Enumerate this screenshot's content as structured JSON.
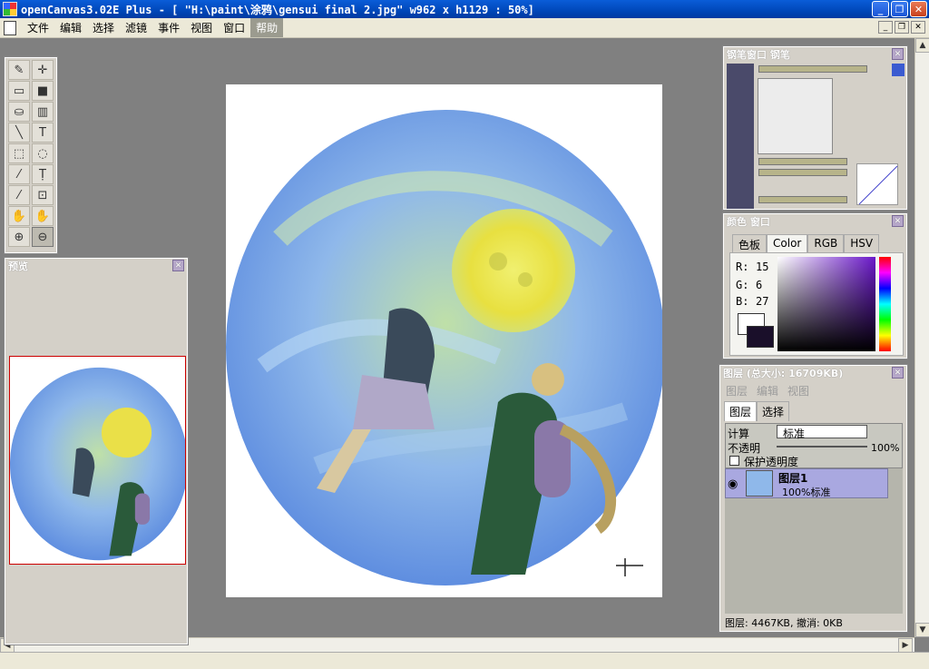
{
  "window": {
    "title": "openCanvas3.02E Plus - [ \"H:\\paint\\涂鸦\\gensui final 2.jpg\" w962 x h1129 : 50%]"
  },
  "menu": {
    "items": [
      "文件",
      "编辑",
      "选择",
      "滤镜",
      "事件",
      "视图",
      "窗口",
      "帮助"
    ]
  },
  "tools": {
    "icons": [
      "pen-icon",
      "move-icon",
      "eraser-icon",
      "fill-rect-icon",
      "bucket-icon",
      "gradient-icon",
      "line-icon",
      "text-icon",
      "rect-select-icon",
      "lasso-icon",
      "magic-wand-icon",
      "text-select-icon",
      "eyedropper-icon",
      "crop-icon",
      "hand-icon",
      "rotate-hand-icon",
      "zoom-in-icon",
      "zoom-out-icon"
    ],
    "glyphs": [
      "✎",
      "✛",
      "▭",
      "■",
      "⛀",
      "▥",
      "╲",
      "T",
      "⬚",
      "◌",
      "⁄",
      "Ṭ",
      "⁄",
      "⊡",
      "✋",
      "✋",
      "⊕",
      "⊖"
    ]
  },
  "preview": {
    "title": "预览"
  },
  "brush": {
    "title": "钢笔窗口  钢笔"
  },
  "color": {
    "title": "颜色  窗口",
    "tabs": [
      "色板",
      "Color",
      "RGB",
      "HSV"
    ],
    "active_tab": "Color",
    "r_label": "R:",
    "r_value": "15",
    "g_label": "G:",
    "g_value": "6",
    "b_label": "B:",
    "b_value": "27",
    "foreground": "#1a0f2a",
    "background": "#ffffff"
  },
  "layers": {
    "title": "图层 (总大小: 16709KB)",
    "sub": [
      "图层",
      "编辑",
      "视图"
    ],
    "tabs": [
      "图层",
      "选择"
    ],
    "blend_label": "计算",
    "blend_value": "标准",
    "opacity_label": "不透明",
    "opacity_value": "100%",
    "protect_label": "保护透明度",
    "layer_name": "图层1",
    "layer_info": "100%标准",
    "status": "图层: 4467KB, 撤消: 0KB"
  }
}
